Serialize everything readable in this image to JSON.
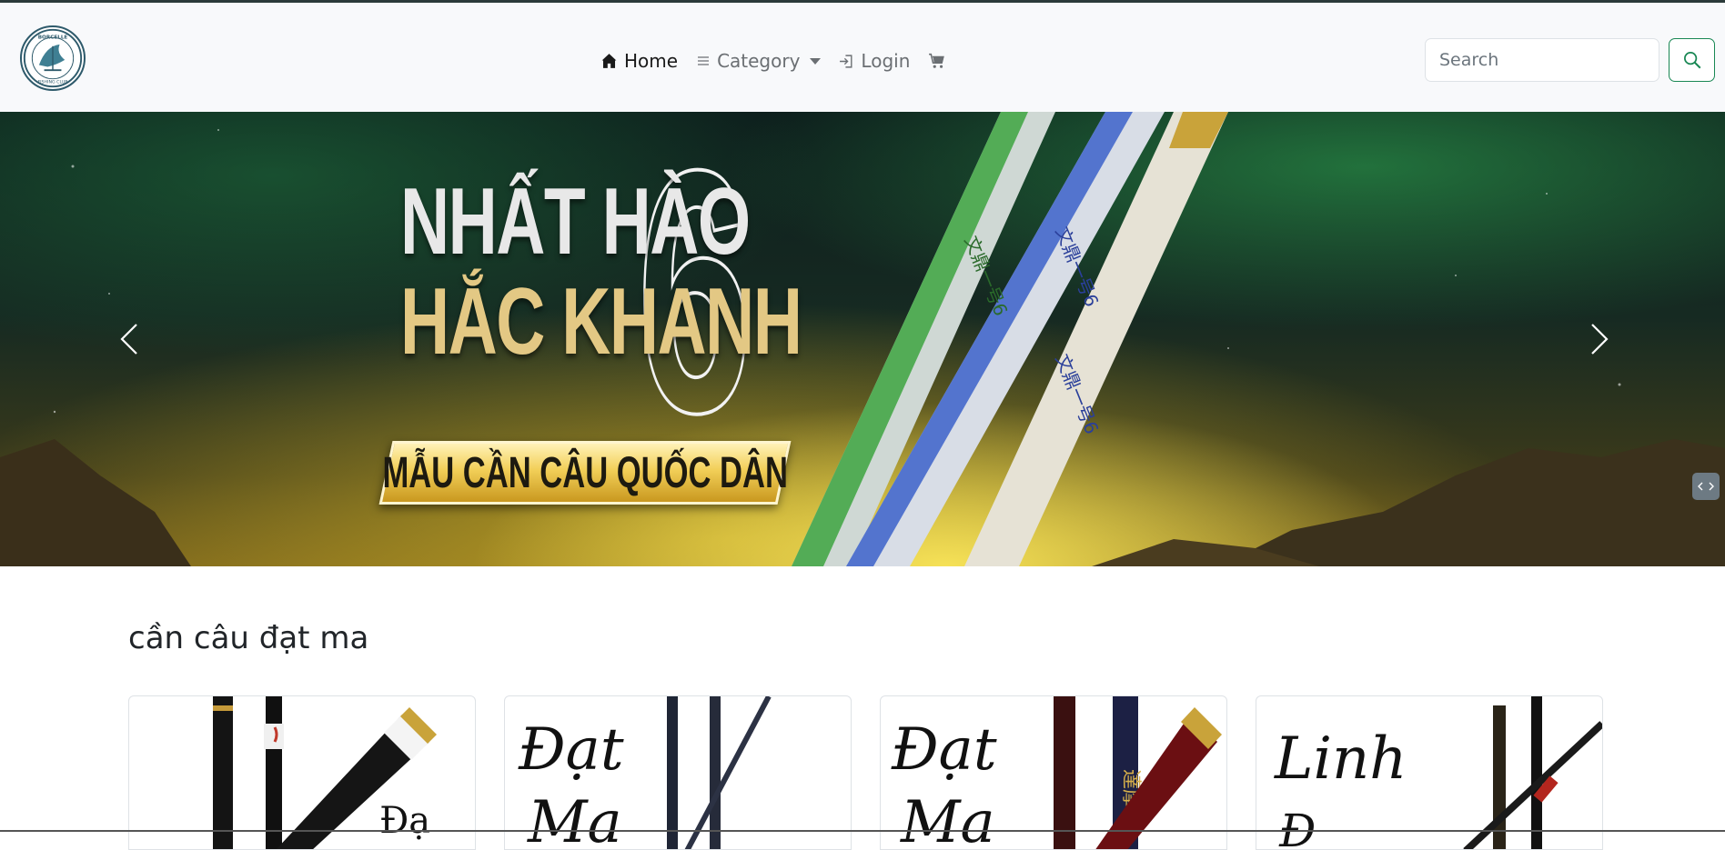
{
  "navbar": {
    "logo_text": "BORCELLE FISHING CLUB",
    "items": [
      {
        "label": "Home",
        "icon": "home-icon",
        "active": true
      },
      {
        "label": "Category",
        "icon": "list-icon",
        "dropdown": true
      },
      {
        "label": "Login",
        "icon": "login-icon"
      }
    ],
    "cart_icon": "cart-icon",
    "search": {
      "placeholder": "Search",
      "value": "",
      "button_icon": "search-icon"
    }
  },
  "banner": {
    "line1": "NHẤT HÀO",
    "line2": "HẮC KHANH",
    "big_number": "6",
    "pill_text": "MẪU CẦN CÂU QUỐC DÂN",
    "prev_icon": "chevron-left-icon",
    "next_icon": "chevron-right-icon"
  },
  "section": {
    "title": "cần câu đạt ma",
    "cards": [
      {
        "name": "product-card-1"
      },
      {
        "name": "product-card-2"
      },
      {
        "name": "product-card-3"
      },
      {
        "name": "product-card-4"
      }
    ]
  },
  "colors": {
    "accent": "#198754",
    "nav_text": "#6b6f73",
    "active_text": "#1a1a1a"
  }
}
